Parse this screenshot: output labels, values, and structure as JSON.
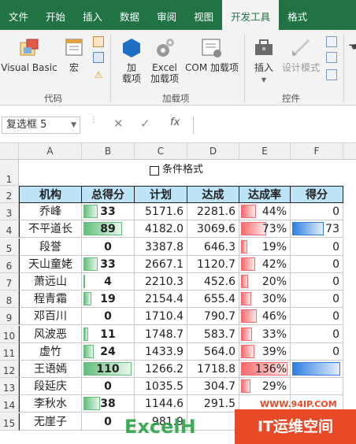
{
  "ribbon_tabs": [
    "文件",
    "开始",
    "插入",
    "数据",
    "审阅",
    "视图",
    "开发工具",
    "格式"
  ],
  "active_tab": "开发工具",
  "ribbon": {
    "visual_basic": "Visual Basic",
    "macros": "宏",
    "addins1": "加",
    "addins2": "载项",
    "excel_addins1": "Excel",
    "excel_addins2": "加载项",
    "com_addins": "COM 加载项",
    "insert": "插入",
    "design_mode": "设计模式",
    "group_code": "代码",
    "group_addins": "加载项",
    "group_controls": "控件"
  },
  "formula_bar": {
    "name_box": "复选框 5",
    "fx": "fx",
    "formula": ""
  },
  "columns": [
    "A",
    "B",
    "C",
    "D",
    "E",
    "F"
  ],
  "row_numbers": [
    "1",
    "2",
    "3",
    "4",
    "5",
    "6",
    "7",
    "8",
    "9",
    "10",
    "11",
    "12",
    "13",
    "14",
    "15"
  ],
  "checkbox_label": "条件格式",
  "table": {
    "headers": [
      "机构",
      "总得分",
      "计划",
      "达成",
      "达成率",
      "得分"
    ],
    "rows": [
      {
        "org": "乔峰",
        "score": "33",
        "plan": "5171.6",
        "done": "2281.6",
        "rate": "44%",
        "pts": "0"
      },
      {
        "org": "不平道长",
        "score": "89",
        "plan": "4182.0",
        "done": "3069.6",
        "rate": "73%",
        "pts": "73"
      },
      {
        "org": "段誉",
        "score": "0",
        "plan": "3387.8",
        "done": "646.3",
        "rate": "19%",
        "pts": "0"
      },
      {
        "org": "天山童姥",
        "score": "33",
        "plan": "2667.1",
        "done": "1120.7",
        "rate": "42%",
        "pts": "0"
      },
      {
        "org": "萧远山",
        "score": "4",
        "plan": "2210.3",
        "done": "452.6",
        "rate": "20%",
        "pts": "0"
      },
      {
        "org": "程青霜",
        "score": "19",
        "plan": "2154.4",
        "done": "655.4",
        "rate": "30%",
        "pts": "0"
      },
      {
        "org": "邓百川",
        "score": "0",
        "plan": "1710.4",
        "done": "790.7",
        "rate": "46%",
        "pts": "0"
      },
      {
        "org": "风波恶",
        "score": "11",
        "plan": "1748.7",
        "done": "583.7",
        "rate": "33%",
        "pts": "0"
      },
      {
        "org": "虚竹",
        "score": "24",
        "plan": "1433.9",
        "done": "564.0",
        "rate": "39%",
        "pts": "0"
      },
      {
        "org": "王语嫣",
        "score": "110",
        "plan": "1266.2",
        "done": "1718.8",
        "rate": "136%",
        "pts": ""
      },
      {
        "org": "段延庆",
        "score": "0",
        "plan": "1035.5",
        "done": "304.7",
        "rate": "29%",
        "pts": ""
      },
      {
        "org": "李秋水",
        "score": "38",
        "plan": "1144.6",
        "done": "291.5",
        "rate": "",
        "pts": ""
      },
      {
        "org": "无崖子",
        "score": "0",
        "plan": "981.9",
        "done": "",
        "rate": "",
        "pts": ""
      }
    ],
    "score_fill": [
      0.3,
      0.81,
      0,
      0.3,
      0.04,
      0.17,
      0,
      0.1,
      0.22,
      1.0,
      0,
      0.35,
      0
    ],
    "rate_fill": [
      0.32,
      0.54,
      0.14,
      0.31,
      0.15,
      0.22,
      0.34,
      0.24,
      0.29,
      1.0,
      0.21,
      0,
      0
    ],
    "pts_fill": [
      0,
      0.66,
      0,
      0,
      0,
      0,
      0,
      0,
      0,
      1.0,
      0,
      0,
      0
    ]
  },
  "colors": {
    "ribbon": "#217346",
    "header_fill": "#bde3f7",
    "score_bar": "#63be7b",
    "rate_bar": "#f8696b",
    "pts_bar": "#2e7fe0"
  },
  "watermark": {
    "logo": "ExcelH",
    "site": "WWW.94IP.COM",
    "brand": "IT运维空间"
  }
}
